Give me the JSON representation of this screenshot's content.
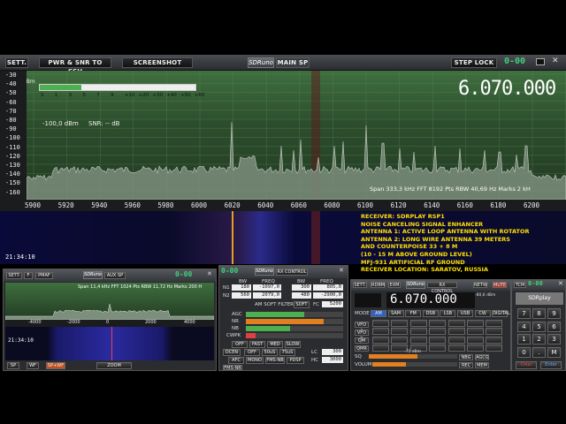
{
  "main": {
    "sett": "SETT.",
    "pwr_csv": "PWR & SNR TO CSV",
    "screenshot": "SCREENSHOT",
    "logo": "SDRuno",
    "tab": "MAIN SP",
    "step_lock": "STEP LOCK",
    "dig": "0-00",
    "freq": "6.070.000",
    "dbm_unit": "dBm",
    "dbm_value": "-100,0 dBm",
    "snr": "SNR: -- dB",
    "meter_scale": [
      "S",
      "1",
      "3",
      "5",
      "7",
      "9",
      "+10",
      "+20",
      "+30",
      "+40",
      "+50",
      "+60"
    ],
    "y_labels": [
      "-30",
      "-40",
      "-50",
      "-60",
      "-70",
      "-80",
      "-90",
      "-100",
      "-110",
      "-120",
      "-130",
      "-140",
      "-150",
      "-160"
    ],
    "x_labels": [
      "5900",
      "5920",
      "5940",
      "5960",
      "5980",
      "6000",
      "6020",
      "6040",
      "6060",
      "6080",
      "6100",
      "6120",
      "6140",
      "6160",
      "6180",
      "6200"
    ],
    "status": "Span 333,3 kHz   FFT 8192 Pts   RBW 40,69 Hz   Marks 2 kH",
    "time": "21:34:10"
  },
  "info_lines": [
    "RECEIVER: SDRPLAY RSP1",
    "NOISE CANCELING SIGNAL ENHANCER",
    "ANTENNA 1: ACTIVE LOOP ANTENNA WITH ROTATOR",
    "ANTENNA 2: LONG WIRE ANTENNA 39 METERS",
    "AND COUNTERPOISE 33 + 8 M",
    "(10 - 15 M ABOVE GROUND LEVEL)",
    "MFJ-931 ARTIFICIAL RF GROUND",
    "RECEIVER LOCATION: SARATOV, RUSSIA"
  ],
  "aux": {
    "sett": "SETT.",
    "f": "F",
    "pmaf": "PMAF",
    "logo": "SDRuno",
    "tab": "AUX SP",
    "dig": "0-00",
    "status": "Span 11,4 kHz   FFT 1024 Pts   RBW 11,72 Hz   Marks 200 H",
    "time": "21:34:10",
    "x_labels": [
      "-4000",
      "-2000",
      "0",
      "2000",
      "4000"
    ],
    "sp": "SP",
    "wf": "WF",
    "spwf": "SP+WF",
    "zoom": "ZOOM"
  },
  "rx": {
    "logo": "SDRuno",
    "tab": "RX CONTROL",
    "dig": "0-00",
    "bw_h": "BW",
    "freq_h": "FREQ",
    "bw_h2": "BW",
    "freq_h2": "FREQ",
    "n1": "N1",
    "n1_bw": "180",
    "n1_freq": "-1097,0",
    "n1_bw2": "300",
    "n1_freq2": "805,0",
    "n2": "N2",
    "n2_bw": "560",
    "n2_freq": "2079,0",
    "n2_bw2": "480",
    "n2_freq2": "-2900,0",
    "amsoft": "AM SOFT FILTER",
    "soft": "SOFT",
    "fc": "FC",
    "fc_val": "5200",
    "agc": "AGC",
    "nr": "NR",
    "nb": "NB",
    "cwpk": "CWPK",
    "off": "OFF",
    "fast": "FAST",
    "med": "MED",
    "slow": "SLOW",
    "n75": "75uS",
    "n50": "50uS",
    "dcen": "DCEN",
    "off2": "OFF",
    "n50b": "50uS",
    "n75b": "75uS",
    "lc": "LC",
    "lc_val": "300",
    "afc": "AFC",
    "mono": "MONO",
    "fmsnb": "FMS-NB",
    "pdsp": "PDSP",
    "hc": "HC",
    "hc_val": "3000",
    "fmsnr": "FMS-NR"
  },
  "rsp": {
    "tab": "RX CONTROL",
    "logo": "SDRuno",
    "dig": "0-00",
    "sett": "SETT.",
    "rdbm": "RDBM",
    "exm": "EXM",
    "netw": "NETW",
    "mute": "MUTE",
    "tcm": "TCM",
    "freq": "6.070.000",
    "unit": "-80,6 dBm",
    "mode": "MODE",
    "vfo": "VFO",
    "vfoa": "VFO A",
    "vfob": "VFO B",
    "qm": "QM",
    "qmr": "QMR",
    "mode_btns": [
      "AM",
      "SAM",
      "FM",
      "DSB",
      "LSB",
      "USB",
      "CW",
      "DIGITAL"
    ],
    "rec": "REC",
    "sq": "SQ",
    "vol": "VOLUME",
    "nbg": "NBG",
    "agcg": "AGCG",
    "squelch": "-70 dBm",
    "mem": "MEM",
    "clear": "Clear",
    "enter": "Enter",
    "keys": [
      "7",
      "8",
      "9",
      "4",
      "5",
      "6",
      "1",
      "2",
      "3",
      "0",
      ".",
      "M"
    ],
    "rsp_logo": "SDRplay"
  }
}
